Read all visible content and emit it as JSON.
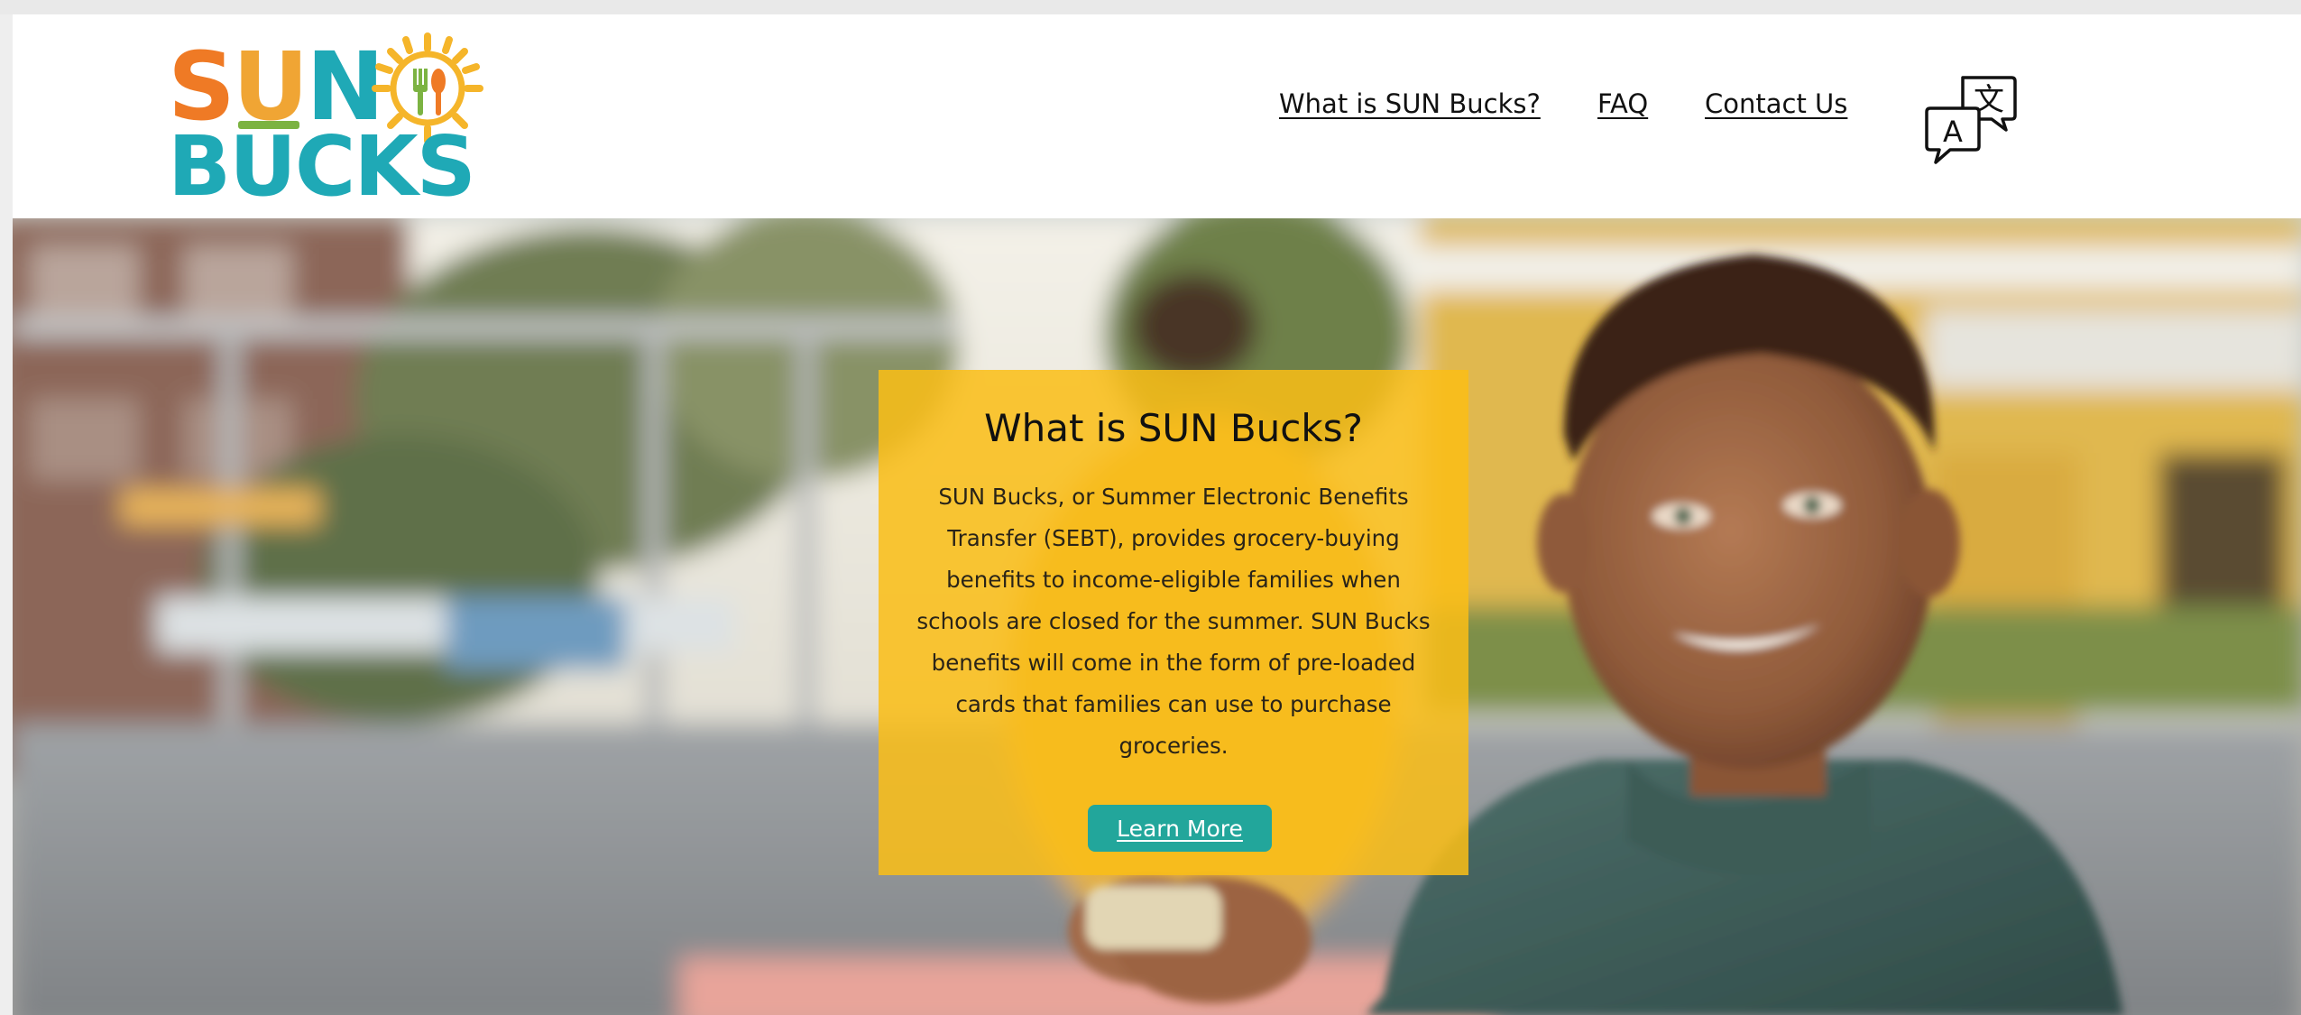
{
  "logo": {
    "top_s": "S",
    "top_u": "U",
    "top_n": "N",
    "bottom": "BUCKS",
    "sun_icon": "sun-with-fork-spoon-icon"
  },
  "nav": {
    "items": [
      {
        "label": "What is SUN Bucks?"
      },
      {
        "label": "FAQ"
      },
      {
        "label": "Contact Us"
      }
    ],
    "translate_icon": "translate-icon",
    "translate_glyph_zh": "文",
    "translate_glyph_a": "A"
  },
  "hero": {
    "card": {
      "title": "What is SUN Bucks?",
      "body": "SUN Bucks, or Summer Electronic Benefits Transfer (SEBT), provides grocery-buying benefits to income-eligible families when schools are closed for the summer. SUN Bucks benefits will come in the form of pre-loaded cards that families can use to purchase groceries.",
      "button_label": "Learn More"
    }
  },
  "colors": {
    "orange": "#ef7a25",
    "teal": "#1fa9b6",
    "green": "#7cb342",
    "sun_yellow": "#f5b52a",
    "card_yellow": "#fabe16",
    "button_teal": "#22a69b"
  }
}
